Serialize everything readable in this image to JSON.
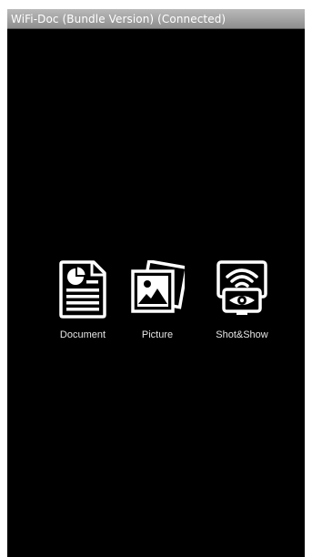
{
  "window": {
    "title": "WiFi-Doc (Bundle Version) (Connected)"
  },
  "menu": {
    "items": [
      {
        "label": "Document",
        "icon": "document-icon"
      },
      {
        "label": "Picture",
        "icon": "picture-icon"
      },
      {
        "label": "Shot&Show",
        "icon": "shot-show-icon"
      }
    ]
  },
  "colors": {
    "background": "#000000",
    "titlebar": "#a3a3a3",
    "icon": "#ffffff",
    "label": "#e6e6e6"
  }
}
